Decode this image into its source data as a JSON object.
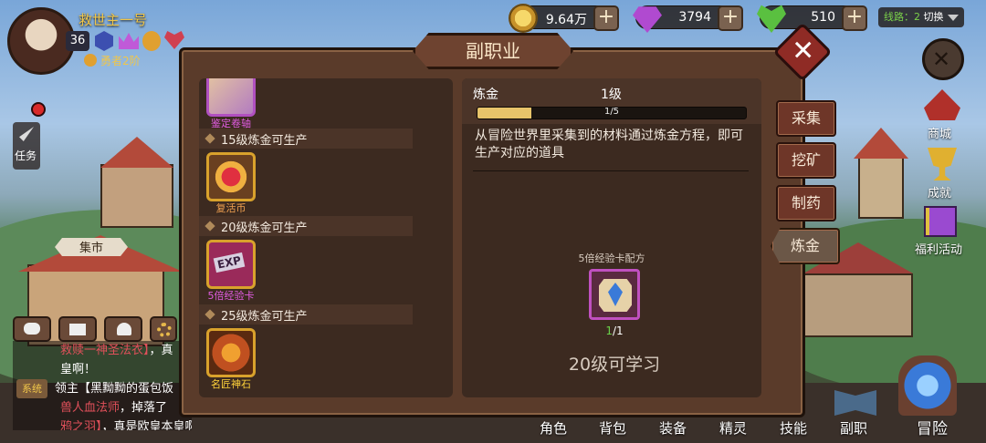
{
  "player": {
    "name": "救世主一号",
    "level": "36",
    "rank": "勇者2阶"
  },
  "resources": {
    "gold": {
      "value": "9.64万",
      "icon": "gold-coin-icon"
    },
    "gems": {
      "value": "3794",
      "icon": "purple-gem-icon"
    },
    "stamina": {
      "value": "510",
      "icon": "green-heart-icon"
    }
  },
  "line_switch": {
    "label": "线路：",
    "value": "2",
    "action": "切换"
  },
  "side_menu": {
    "task": "任务",
    "market": "集市",
    "shop": "商城",
    "achievement": "成就",
    "welfare": "福利活动"
  },
  "dialog": {
    "title": "副职业",
    "close": "✕",
    "tabs": [
      "采集",
      "挖矿",
      "制药",
      "炼金"
    ],
    "active_tab": "炼金",
    "recipes": [
      {
        "name": "鉴定卷轴",
        "name_color": "#e05ce0"
      },
      {
        "unlock": "15级炼金可生产"
      },
      {
        "name": "复活币",
        "name_color": "#f0a050"
      },
      {
        "unlock": "20级炼金可生产"
      },
      {
        "name": "5倍经验卡",
        "name_color": "#e05ce0",
        "badge": "EXP"
      },
      {
        "unlock": "25级炼金可生产"
      },
      {
        "name": "名匠神石",
        "name_color": "#ffd23a"
      }
    ],
    "skill": {
      "name": "炼金",
      "level": "1级",
      "progress_text": "1/5",
      "progress_fraction": 0.2,
      "description": "从冒险世界里采集到的材料通过炼金方程，即可生产对应的道具"
    },
    "formula": {
      "title": "5倍经验卡配方",
      "material_have": "1",
      "material_need": "/1",
      "learn_req": "20级可学习"
    }
  },
  "chat": {
    "line1_name": "救赎一神圣法衣】",
    "line1_rest": "，真",
    "line2": "皇啊！",
    "system_tag": "系统",
    "line3": "领主【黑黝黝的蛋包饭",
    "line4_name": "兽人血法师",
    "line4_rest": "，掉落了",
    "line5_name": "鸦之羽】",
    "line5_rest": "，真是欧皇本皇啊！"
  },
  "bottom_nav": [
    "角色",
    "背包",
    "装备",
    "精灵",
    "技能",
    "副职",
    "冒险"
  ]
}
